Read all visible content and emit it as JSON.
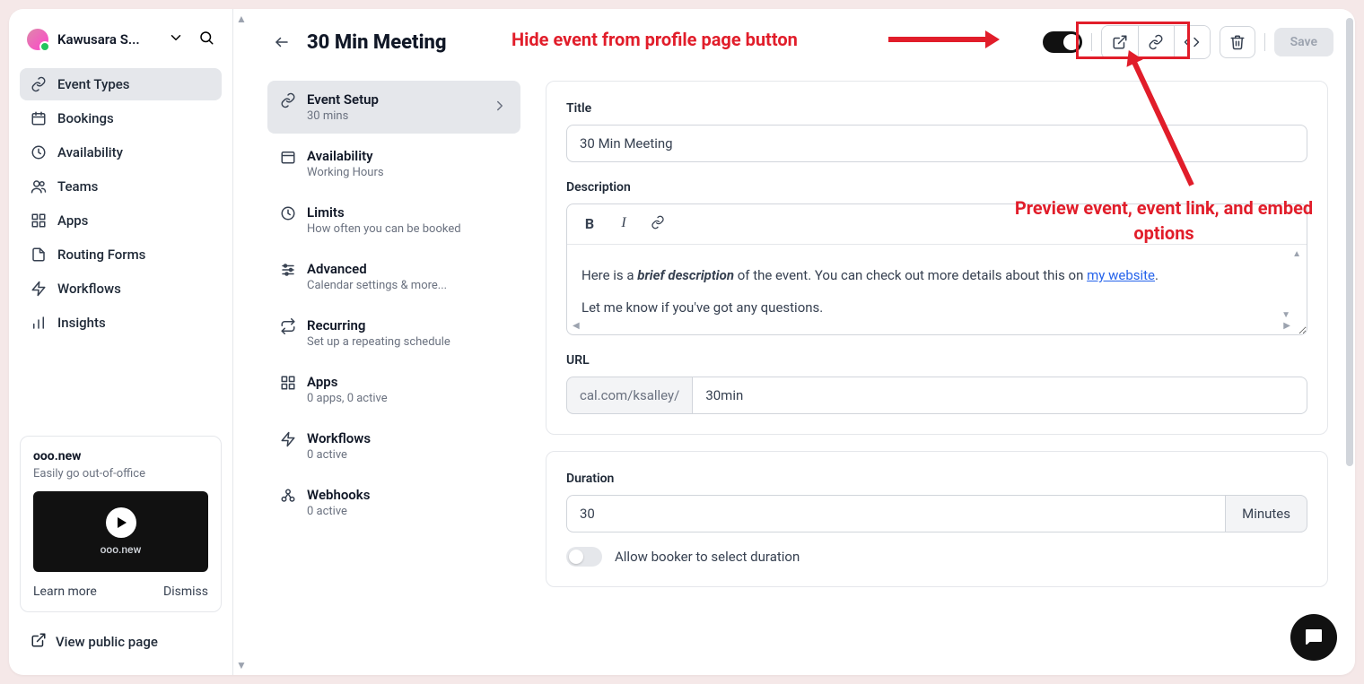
{
  "user": {
    "name": "Kawusara S..."
  },
  "nav": {
    "items": [
      {
        "label": "Event Types",
        "active": true
      },
      {
        "label": "Bookings"
      },
      {
        "label": "Availability"
      },
      {
        "label": "Teams"
      },
      {
        "label": "Apps"
      },
      {
        "label": "Routing Forms"
      },
      {
        "label": "Workflows"
      },
      {
        "label": "Insights"
      }
    ]
  },
  "promo": {
    "title": "ooo.new",
    "sub": "Easily go out-of-office",
    "badge": "ooo.new",
    "learn": "Learn more",
    "dismiss": "Dismiss"
  },
  "view_public": "View public page",
  "page": {
    "title": "30 Min Meeting",
    "save": "Save"
  },
  "subnav": {
    "items": [
      {
        "label": "Event Setup",
        "desc": "30 mins",
        "active": true
      },
      {
        "label": "Availability",
        "desc": "Working Hours"
      },
      {
        "label": "Limits",
        "desc": "How often you can be booked"
      },
      {
        "label": "Advanced",
        "desc": "Calendar settings & more..."
      },
      {
        "label": "Recurring",
        "desc": "Set up a repeating schedule"
      },
      {
        "label": "Apps",
        "desc": "0 apps, 0 active"
      },
      {
        "label": "Workflows",
        "desc": "0 active"
      },
      {
        "label": "Webhooks",
        "desc": "0 active"
      }
    ]
  },
  "form": {
    "title_label": "Title",
    "title_value": "30 Min Meeting",
    "desc_label": "Description",
    "desc_p1_pre": "Here is a ",
    "desc_p1_bi": "brief description",
    "desc_p1_mid": " of the event. You can check out more details about this on ",
    "desc_p1_link": "my website",
    "desc_p1_post": ".",
    "desc_p2": "Let me know if you've got any questions.",
    "url_label": "URL",
    "url_prefix": "cal.com/ksalley/",
    "url_value": "30min",
    "dur_label": "Duration",
    "dur_value": "30",
    "dur_suffix": "Minutes",
    "allow_select": "Allow booker to select duration"
  },
  "annotations": {
    "hide": "Hide event from profile page button",
    "preview": "Preview event, event link, and embed options"
  }
}
